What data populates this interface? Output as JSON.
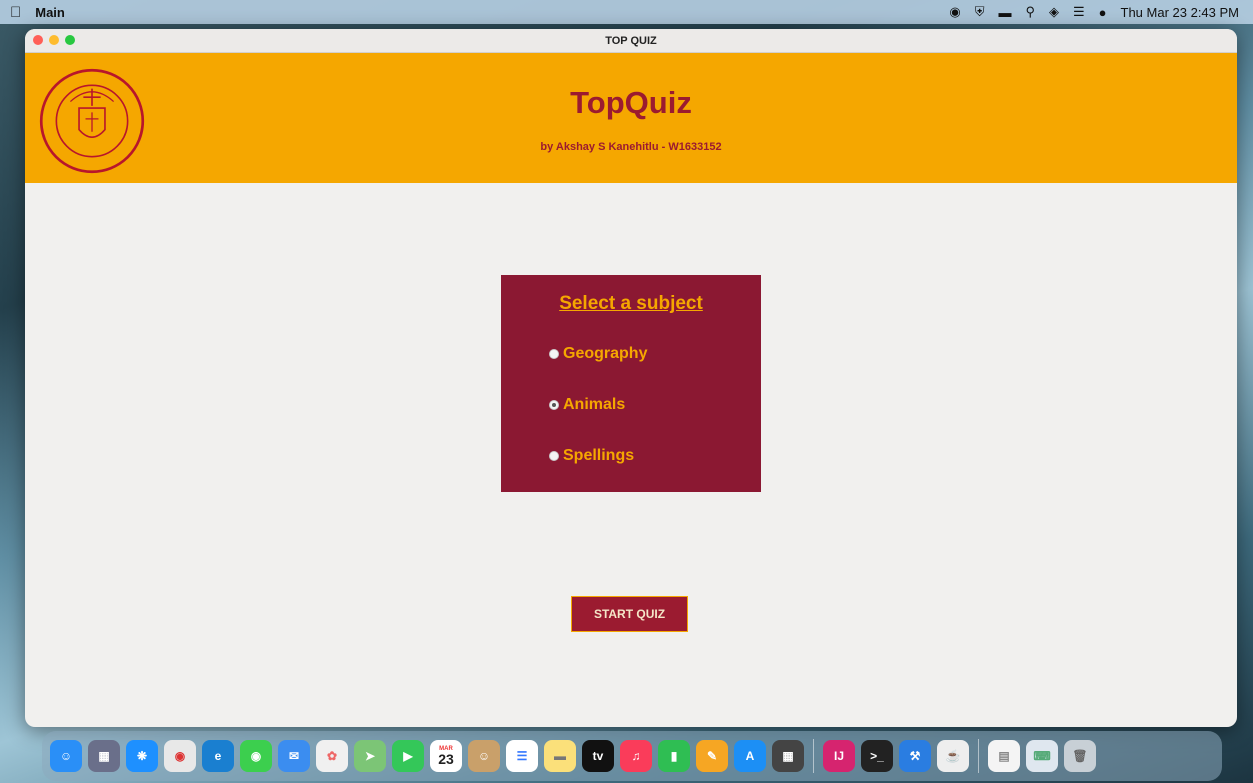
{
  "menubar": {
    "app_name": "Main",
    "clock": "Thu Mar 23  2:43 PM"
  },
  "window": {
    "title": "TOP QUIZ"
  },
  "header": {
    "title": "TopQuiz",
    "subtitle": "by Akshay S Kanehitlu - W1633152"
  },
  "panel": {
    "heading": "Select a subject",
    "options": [
      {
        "label": "Geography",
        "selected": false
      },
      {
        "label": "Animals",
        "selected": true
      },
      {
        "label": "Spellings",
        "selected": false
      }
    ]
  },
  "start_button": {
    "label": "START QUIZ"
  },
  "dock": {
    "apps": [
      "finder-icon",
      "launchpad-icon",
      "safari-icon",
      "chrome-icon",
      "edge-icon",
      "messages-icon",
      "mail-icon",
      "photos-icon",
      "maps-icon",
      "facetime-icon",
      "calendar-icon",
      "contacts-icon",
      "reminders-icon",
      "notes-icon",
      "tv-icon",
      "music-icon",
      "numbers-icon",
      "pages-icon",
      "app-store-icon",
      "calculator-icon",
      "intellij-icon",
      "terminal-icon",
      "xcode-icon",
      "java-icon",
      "preview-icon",
      "keyboard-icon",
      "trash-icon"
    ],
    "calendar_month": "MAR",
    "calendar_day": "23",
    "tv_label": "tv",
    "intellij_label": "IJ"
  },
  "colors": {
    "gold": "#f5a700",
    "maroon": "#8b1832",
    "title_red": "#9b1b30"
  }
}
